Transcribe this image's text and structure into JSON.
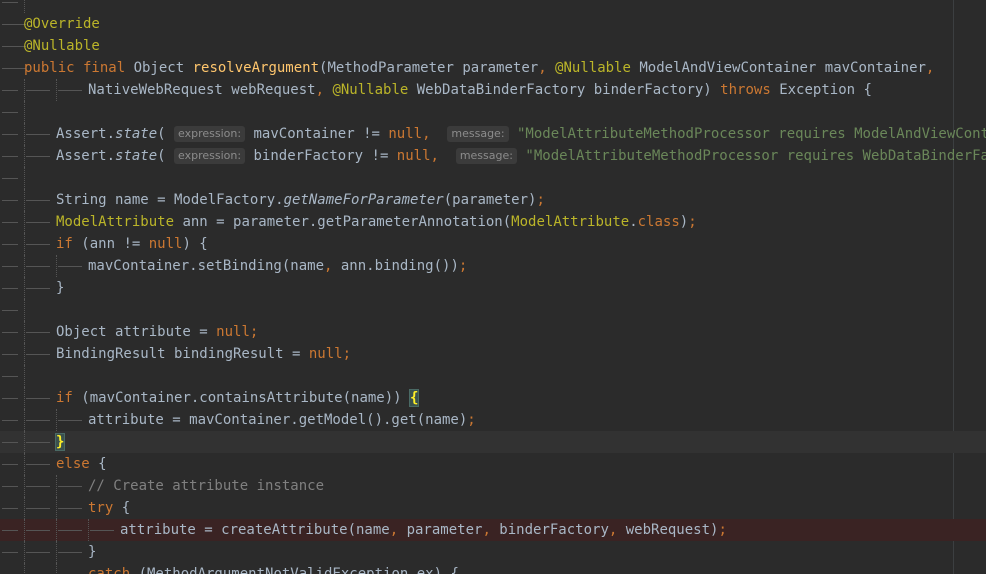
{
  "editor": {
    "lines": [
      {
        "guides": [
          24
        ],
        "segs": []
      },
      {
        "guides": [],
        "segs": [
          {
            "t": "@Override",
            "c": "ann"
          }
        ]
      },
      {
        "guides": [],
        "segs": [
          {
            "t": "@Nullable",
            "c": "ann"
          }
        ]
      },
      {
        "guides": [],
        "segs": [
          {
            "t": "public final ",
            "c": "kw"
          },
          {
            "t": "Object "
          },
          {
            "t": "resolveArgument",
            "c": "fn"
          },
          {
            "t": "(MethodParameter parameter"
          },
          {
            "t": ", ",
            "c": "kw"
          },
          {
            "t": "@Nullable ",
            "c": "ann"
          },
          {
            "t": "ModelAndViewContainer mavContainer"
          },
          {
            "t": ",",
            "c": "kw"
          }
        ]
      },
      {
        "guides": [
          24,
          56
        ],
        "segs": [
          {
            "t": "NativeWebRequest webRequest"
          },
          {
            "t": ", ",
            "c": "kw"
          },
          {
            "t": "@Nullable ",
            "c": "ann"
          },
          {
            "t": "WebDataBinderFactory binderFactory) "
          },
          {
            "t": "throws ",
            "c": "kw"
          },
          {
            "t": "Exception {"
          }
        ]
      },
      {
        "guides": [
          24
        ],
        "segs": []
      },
      {
        "guides": [
          24
        ],
        "segs": [
          {
            "t": "Assert."
          },
          {
            "t": "state",
            "c": "it"
          },
          {
            "t": "( "
          },
          {
            "h": "expression:"
          },
          {
            "t": " mavContainer != "
          },
          {
            "t": "null",
            "c": "kw"
          },
          {
            "t": ",  ",
            "c": "kw"
          },
          {
            "h": "message:"
          },
          {
            "t": " "
          },
          {
            "t": "\"ModelAttributeMethodProcessor requires ModelAndViewContainer\"",
            "c": "str"
          },
          {
            "t": ")"
          },
          {
            "t": ";",
            "c": "kw"
          }
        ]
      },
      {
        "guides": [
          24
        ],
        "segs": [
          {
            "t": "Assert."
          },
          {
            "t": "state",
            "c": "it"
          },
          {
            "t": "( "
          },
          {
            "h": "expression:"
          },
          {
            "t": " binderFactory != "
          },
          {
            "t": "null",
            "c": "kw"
          },
          {
            "t": ",  ",
            "c": "kw"
          },
          {
            "h": "message:"
          },
          {
            "t": " "
          },
          {
            "t": "\"ModelAttributeMethodProcessor requires WebDataBinderFactory\"",
            "c": "str"
          },
          {
            "t": ")"
          },
          {
            "t": ";",
            "c": "kw"
          }
        ]
      },
      {
        "guides": [
          24
        ],
        "segs": []
      },
      {
        "guides": [
          24
        ],
        "segs": [
          {
            "t": "String name = ModelFactory."
          },
          {
            "t": "getNameForParameter",
            "c": "it"
          },
          {
            "t": "(parameter)"
          },
          {
            "t": ";",
            "c": "kw"
          }
        ]
      },
      {
        "guides": [
          24
        ],
        "segs": [
          {
            "t": "ModelAttribute ",
            "c": "ann"
          },
          {
            "t": "ann = parameter.getParameterAnnotation("
          },
          {
            "t": "ModelAttribute",
            "c": "ann"
          },
          {
            "t": "."
          },
          {
            "t": "class",
            "c": "kw"
          },
          {
            "t": ")"
          },
          {
            "t": ";",
            "c": "kw"
          }
        ]
      },
      {
        "guides": [
          24
        ],
        "segs": [
          {
            "t": "if ",
            "c": "kw"
          },
          {
            "t": "(ann != "
          },
          {
            "t": "null",
            "c": "kw"
          },
          {
            "t": ") {"
          }
        ]
      },
      {
        "guides": [
          24,
          56
        ],
        "segs": [
          {
            "t": "mavContainer.setBinding(name"
          },
          {
            "t": ", ",
            "c": "kw"
          },
          {
            "t": "ann.binding())"
          },
          {
            "t": ";",
            "c": "kw"
          }
        ]
      },
      {
        "guides": [
          24
        ],
        "segs": [
          {
            "t": "}"
          }
        ]
      },
      {
        "guides": [
          24
        ],
        "segs": []
      },
      {
        "guides": [
          24
        ],
        "segs": [
          {
            "t": "Object attribute = "
          },
          {
            "t": "null;",
            "c": "kw"
          }
        ]
      },
      {
        "guides": [
          24
        ],
        "segs": [
          {
            "t": "BindingResult bindingResult = "
          },
          {
            "t": "null;",
            "c": "kw"
          }
        ]
      },
      {
        "guides": [
          24
        ],
        "segs": []
      },
      {
        "guides": [
          24
        ],
        "segs": [
          {
            "t": "if ",
            "c": "kw"
          },
          {
            "t": "(mavContainer.containsAttribute(name)) "
          },
          {
            "t": "{",
            "c": "bm"
          }
        ]
      },
      {
        "guides": [
          24,
          56
        ],
        "segs": [
          {
            "t": "attribute = mavContainer.getModel().get(name)"
          },
          {
            "t": ";",
            "c": "kw"
          }
        ]
      },
      {
        "guides": [
          24
        ],
        "hl": "caret",
        "segs": [
          {
            "t": "}",
            "c": "bm"
          }
        ]
      },
      {
        "guides": [
          24
        ],
        "segs": [
          {
            "t": "else ",
            "c": "kw"
          },
          {
            "t": "{"
          }
        ]
      },
      {
        "guides": [
          24,
          56
        ],
        "segs": [
          {
            "t": "// Create attribute instance",
            "c": "cmt"
          }
        ]
      },
      {
        "guides": [
          24,
          56
        ],
        "segs": [
          {
            "t": "try ",
            "c": "kw"
          },
          {
            "t": "{"
          }
        ]
      },
      {
        "guides": [
          24,
          56,
          88
        ],
        "hl": "bp",
        "segs": [
          {
            "t": "attribute = createAttribute(name"
          },
          {
            "t": ", ",
            "c": "kw"
          },
          {
            "t": "parameter"
          },
          {
            "t": ", ",
            "c": "kw"
          },
          {
            "t": "binderFactory"
          },
          {
            "t": ", ",
            "c": "kw"
          },
          {
            "t": "webRequest)"
          },
          {
            "t": ";",
            "c": "kw"
          }
        ]
      },
      {
        "guides": [
          24,
          56
        ],
        "segs": [
          {
            "t": "}"
          }
        ]
      },
      {
        "guides": [
          24,
          56
        ],
        "segs": [
          {
            "t": "catch ",
            "c": "kw"
          },
          {
            "t": "(MethodArgumentNotValidException ex) {"
          }
        ]
      }
    ]
  }
}
